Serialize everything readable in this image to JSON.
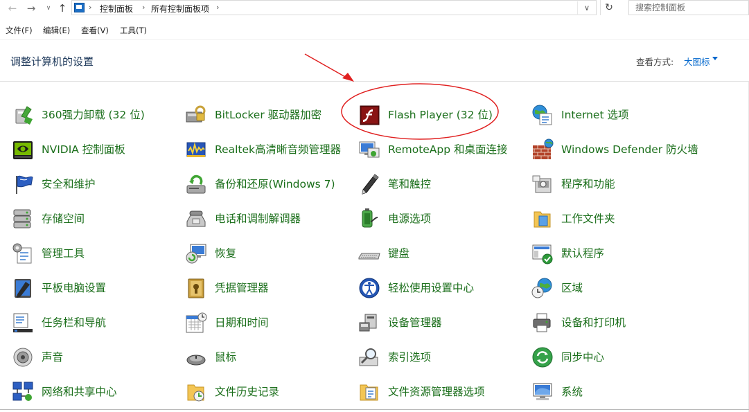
{
  "address": {
    "breadcrumbs": [
      "控制面板",
      "所有控制面板项"
    ],
    "search_placeholder": "搜索控制面板",
    "back_icon": "arrow-left-icon",
    "forward_icon": "arrow-right-icon",
    "up_icon": "arrow-up-icon",
    "refresh_icon": "refresh-icon"
  },
  "menu": [
    "文件(F)",
    "编辑(E)",
    "查看(V)",
    "工具(T)"
  ],
  "header": {
    "title": "调整计算机的设置",
    "view_label": "查看方式:",
    "view_value": "大图标"
  },
  "colors": {
    "label": "#1a6e1a",
    "link": "#0066cc",
    "title": "#1e395b",
    "annotation": "#e02020"
  },
  "items": [
    {
      "label": "360强力卸载 (32 位)",
      "icon": "uninstaller-icon"
    },
    {
      "label": "BitLocker 驱动器加密",
      "icon": "bitlocker-icon"
    },
    {
      "label": "Flash Player (32 位)",
      "icon": "flash-icon"
    },
    {
      "label": "Internet 选项",
      "icon": "internet-options-icon"
    },
    {
      "label": "NVIDIA 控制面板",
      "icon": "nvidia-icon"
    },
    {
      "label": "Realtek高清晰音频管理器",
      "icon": "audio-manager-icon"
    },
    {
      "label": "RemoteApp 和桌面连接",
      "icon": "remoteapp-icon"
    },
    {
      "label": "Windows Defender 防火墙",
      "icon": "firewall-icon"
    },
    {
      "label": "安全和维护",
      "icon": "flag-icon"
    },
    {
      "label": "备份和还原(Windows 7)",
      "icon": "backup-icon"
    },
    {
      "label": "笔和触控",
      "icon": "pen-icon"
    },
    {
      "label": "程序和功能",
      "icon": "programs-icon"
    },
    {
      "label": "存储空间",
      "icon": "storage-icon"
    },
    {
      "label": "电话和调制解调器",
      "icon": "phone-icon"
    },
    {
      "label": "电源选项",
      "icon": "power-icon"
    },
    {
      "label": "工作文件夹",
      "icon": "work-folder-icon"
    },
    {
      "label": "管理工具",
      "icon": "admin-tools-icon"
    },
    {
      "label": "恢复",
      "icon": "recovery-icon"
    },
    {
      "label": "键盘",
      "icon": "keyboard-icon"
    },
    {
      "label": "默认程序",
      "icon": "default-programs-icon"
    },
    {
      "label": "平板电脑设置",
      "icon": "tablet-icon"
    },
    {
      "label": "凭据管理器",
      "icon": "credential-icon"
    },
    {
      "label": "轻松使用设置中心",
      "icon": "ease-of-access-icon"
    },
    {
      "label": "区域",
      "icon": "region-icon"
    },
    {
      "label": "任务栏和导航",
      "icon": "taskbar-icon"
    },
    {
      "label": "日期和时间",
      "icon": "calendar-icon"
    },
    {
      "label": "设备管理器",
      "icon": "device-manager-icon"
    },
    {
      "label": "设备和打印机",
      "icon": "printer-icon"
    },
    {
      "label": "声音",
      "icon": "speaker-icon"
    },
    {
      "label": "鼠标",
      "icon": "mouse-icon"
    },
    {
      "label": "索引选项",
      "icon": "search-index-icon"
    },
    {
      "label": "同步中心",
      "icon": "sync-icon"
    },
    {
      "label": "网络和共享中心",
      "icon": "network-icon"
    },
    {
      "label": "文件历史记录",
      "icon": "file-history-icon"
    },
    {
      "label": "文件资源管理器选项",
      "icon": "folder-options-icon"
    },
    {
      "label": "系统",
      "icon": "computer-icon"
    }
  ]
}
